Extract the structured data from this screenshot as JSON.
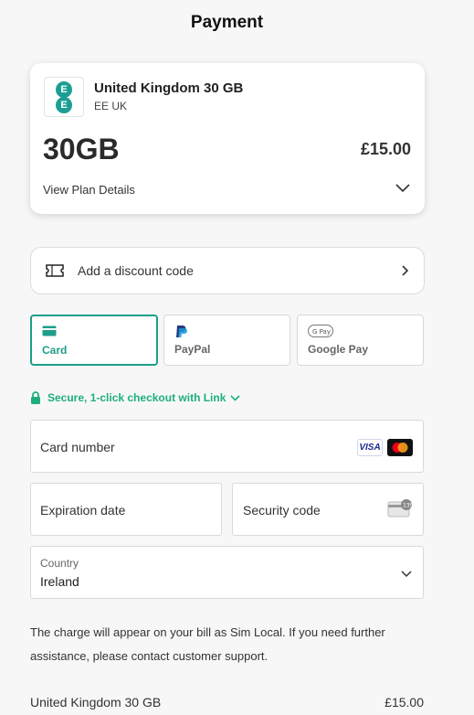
{
  "header": {
    "title": "Payment"
  },
  "plan": {
    "logo_letters": [
      "E",
      "E"
    ],
    "name": "United Kingdom 30 GB",
    "provider": "EE UK",
    "data": "30GB",
    "price": "£15.00",
    "details_label": "View Plan Details"
  },
  "discount": {
    "label": "Add a discount code"
  },
  "payment_methods": [
    {
      "label": "Card",
      "selected": true
    },
    {
      "label": "PayPal",
      "selected": false
    },
    {
      "label": "Google Pay",
      "selected": false
    }
  ],
  "secure_link": {
    "label": "Secure, 1-click checkout with Link"
  },
  "card_form": {
    "card_number_placeholder": "Card number",
    "card_brands": [
      "VISA",
      "mastercard"
    ],
    "expiration_placeholder": "Expiration date",
    "security_code_placeholder": "Security code",
    "country_label": "Country",
    "country_value": "Ireland"
  },
  "notice": "The charge will appear on your bill as Sim Local. If you need further assistance, please contact customer support.",
  "summary": {
    "item": "United Kingdom 30 GB",
    "price": "£15.00"
  },
  "colors": {
    "accent": "#1e9e89",
    "secure_green": "#1daf7a",
    "ee_teal": "#1c9f93"
  }
}
